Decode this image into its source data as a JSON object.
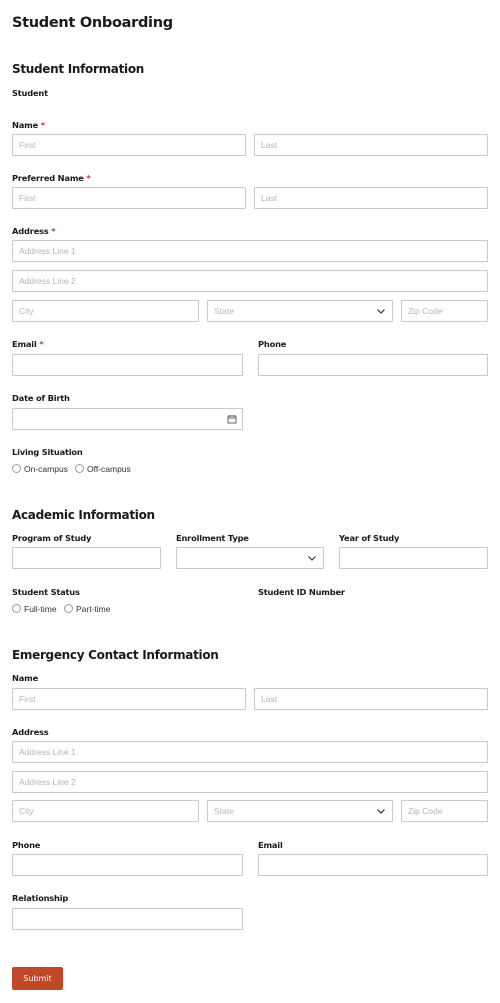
{
  "page": {
    "title": "Student Onboarding"
  },
  "student_info": {
    "heading": "Student Information",
    "subheading": "Student",
    "name": {
      "label": "Name",
      "required": "*",
      "first_placeholder": "First",
      "last_placeholder": "Last"
    },
    "preferred_name": {
      "label": "Preferred Name",
      "required": "*",
      "first_placeholder": "First",
      "last_placeholder": "Last"
    },
    "address": {
      "label": "Address",
      "required": "*",
      "line1_placeholder": "Address Line 1",
      "line2_placeholder": "Address Line 2",
      "city_placeholder": "City",
      "state_placeholder": "State",
      "zip_placeholder": "Zip Code"
    },
    "email": {
      "label": "Email",
      "required": "*"
    },
    "phone": {
      "label": "Phone"
    },
    "dob": {
      "label": "Date of Birth"
    },
    "living": {
      "label": "Living Situation",
      "options": [
        "On-campus",
        "Off-campus"
      ]
    }
  },
  "academic_info": {
    "heading": "Academic Information",
    "program": {
      "label": "Program of Study"
    },
    "enrollment": {
      "label": "Enrollment Type"
    },
    "year": {
      "label": "Year of Study"
    },
    "status": {
      "label": "Student Status",
      "options": [
        "Full-time",
        "Part-time"
      ]
    },
    "student_id": {
      "label": "Student ID Number"
    }
  },
  "emergency_info": {
    "heading": "Emergency Contact Information",
    "name": {
      "label": "Name",
      "first_placeholder": "First",
      "last_placeholder": "Last"
    },
    "address": {
      "label": "Address",
      "line1_placeholder": "Address Line 1",
      "line2_placeholder": "Address Line 2",
      "city_placeholder": "City",
      "state_placeholder": "State",
      "zip_placeholder": "Zip Code"
    },
    "phone": {
      "label": "Phone"
    },
    "email": {
      "label": "Email"
    },
    "relationship": {
      "label": "Relationship"
    }
  },
  "submit": {
    "label": "Submit"
  },
  "colors": {
    "accent": "#c0482a",
    "required": "#c0392b",
    "border": "#c9c9c9",
    "placeholder": "#b5b5b5"
  },
  "icons": {
    "select": "chevron-down-icon",
    "date": "calendar-icon"
  }
}
